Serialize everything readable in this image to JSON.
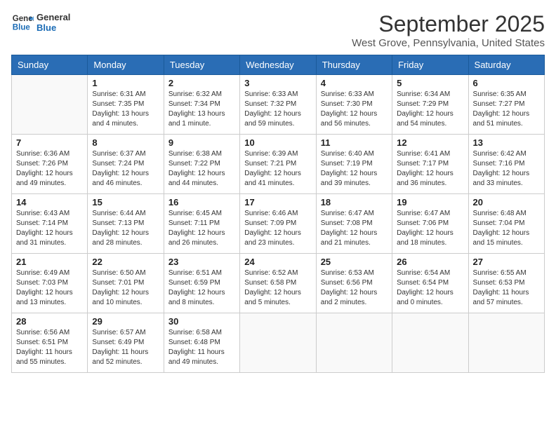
{
  "header": {
    "logo_line1": "General",
    "logo_line2": "Blue",
    "month": "September 2025",
    "location": "West Grove, Pennsylvania, United States"
  },
  "weekdays": [
    "Sunday",
    "Monday",
    "Tuesday",
    "Wednesday",
    "Thursday",
    "Friday",
    "Saturday"
  ],
  "weeks": [
    [
      {
        "day": "",
        "info": ""
      },
      {
        "day": "1",
        "info": "Sunrise: 6:31 AM\nSunset: 7:35 PM\nDaylight: 13 hours\nand 4 minutes."
      },
      {
        "day": "2",
        "info": "Sunrise: 6:32 AM\nSunset: 7:34 PM\nDaylight: 13 hours\nand 1 minute."
      },
      {
        "day": "3",
        "info": "Sunrise: 6:33 AM\nSunset: 7:32 PM\nDaylight: 12 hours\nand 59 minutes."
      },
      {
        "day": "4",
        "info": "Sunrise: 6:33 AM\nSunset: 7:30 PM\nDaylight: 12 hours\nand 56 minutes."
      },
      {
        "day": "5",
        "info": "Sunrise: 6:34 AM\nSunset: 7:29 PM\nDaylight: 12 hours\nand 54 minutes."
      },
      {
        "day": "6",
        "info": "Sunrise: 6:35 AM\nSunset: 7:27 PM\nDaylight: 12 hours\nand 51 minutes."
      }
    ],
    [
      {
        "day": "7",
        "info": "Sunrise: 6:36 AM\nSunset: 7:26 PM\nDaylight: 12 hours\nand 49 minutes."
      },
      {
        "day": "8",
        "info": "Sunrise: 6:37 AM\nSunset: 7:24 PM\nDaylight: 12 hours\nand 46 minutes."
      },
      {
        "day": "9",
        "info": "Sunrise: 6:38 AM\nSunset: 7:22 PM\nDaylight: 12 hours\nand 44 minutes."
      },
      {
        "day": "10",
        "info": "Sunrise: 6:39 AM\nSunset: 7:21 PM\nDaylight: 12 hours\nand 41 minutes."
      },
      {
        "day": "11",
        "info": "Sunrise: 6:40 AM\nSunset: 7:19 PM\nDaylight: 12 hours\nand 39 minutes."
      },
      {
        "day": "12",
        "info": "Sunrise: 6:41 AM\nSunset: 7:17 PM\nDaylight: 12 hours\nand 36 minutes."
      },
      {
        "day": "13",
        "info": "Sunrise: 6:42 AM\nSunset: 7:16 PM\nDaylight: 12 hours\nand 33 minutes."
      }
    ],
    [
      {
        "day": "14",
        "info": "Sunrise: 6:43 AM\nSunset: 7:14 PM\nDaylight: 12 hours\nand 31 minutes."
      },
      {
        "day": "15",
        "info": "Sunrise: 6:44 AM\nSunset: 7:13 PM\nDaylight: 12 hours\nand 28 minutes."
      },
      {
        "day": "16",
        "info": "Sunrise: 6:45 AM\nSunset: 7:11 PM\nDaylight: 12 hours\nand 26 minutes."
      },
      {
        "day": "17",
        "info": "Sunrise: 6:46 AM\nSunset: 7:09 PM\nDaylight: 12 hours\nand 23 minutes."
      },
      {
        "day": "18",
        "info": "Sunrise: 6:47 AM\nSunset: 7:08 PM\nDaylight: 12 hours\nand 21 minutes."
      },
      {
        "day": "19",
        "info": "Sunrise: 6:47 AM\nSunset: 7:06 PM\nDaylight: 12 hours\nand 18 minutes."
      },
      {
        "day": "20",
        "info": "Sunrise: 6:48 AM\nSunset: 7:04 PM\nDaylight: 12 hours\nand 15 minutes."
      }
    ],
    [
      {
        "day": "21",
        "info": "Sunrise: 6:49 AM\nSunset: 7:03 PM\nDaylight: 12 hours\nand 13 minutes."
      },
      {
        "day": "22",
        "info": "Sunrise: 6:50 AM\nSunset: 7:01 PM\nDaylight: 12 hours\nand 10 minutes."
      },
      {
        "day": "23",
        "info": "Sunrise: 6:51 AM\nSunset: 6:59 PM\nDaylight: 12 hours\nand 8 minutes."
      },
      {
        "day": "24",
        "info": "Sunrise: 6:52 AM\nSunset: 6:58 PM\nDaylight: 12 hours\nand 5 minutes."
      },
      {
        "day": "25",
        "info": "Sunrise: 6:53 AM\nSunset: 6:56 PM\nDaylight: 12 hours\nand 2 minutes."
      },
      {
        "day": "26",
        "info": "Sunrise: 6:54 AM\nSunset: 6:54 PM\nDaylight: 12 hours\nand 0 minutes."
      },
      {
        "day": "27",
        "info": "Sunrise: 6:55 AM\nSunset: 6:53 PM\nDaylight: 11 hours\nand 57 minutes."
      }
    ],
    [
      {
        "day": "28",
        "info": "Sunrise: 6:56 AM\nSunset: 6:51 PM\nDaylight: 11 hours\nand 55 minutes."
      },
      {
        "day": "29",
        "info": "Sunrise: 6:57 AM\nSunset: 6:49 PM\nDaylight: 11 hours\nand 52 minutes."
      },
      {
        "day": "30",
        "info": "Sunrise: 6:58 AM\nSunset: 6:48 PM\nDaylight: 11 hours\nand 49 minutes."
      },
      {
        "day": "",
        "info": ""
      },
      {
        "day": "",
        "info": ""
      },
      {
        "day": "",
        "info": ""
      },
      {
        "day": "",
        "info": ""
      }
    ]
  ]
}
